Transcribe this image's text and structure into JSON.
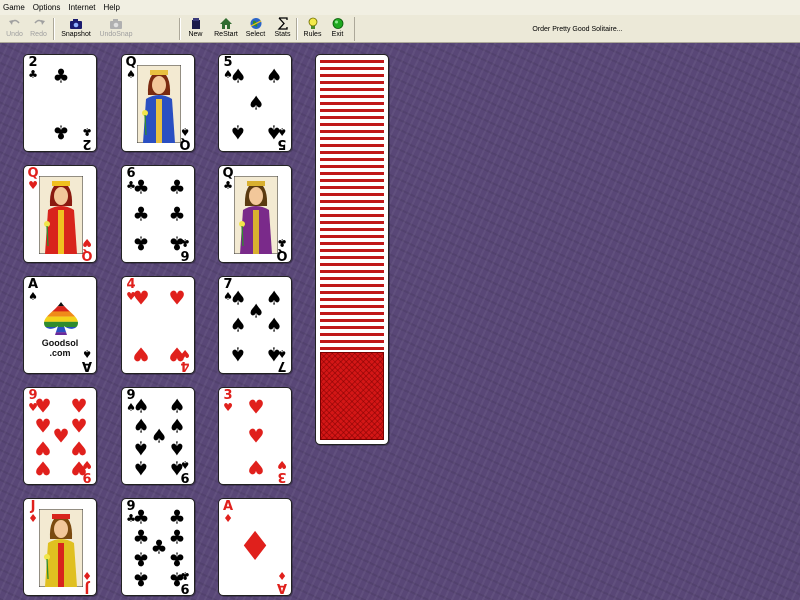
{
  "menu": [
    "Game",
    "Options",
    "Internet",
    "Help"
  ],
  "toolbar": {
    "undo": "Undo",
    "redo": "Redo",
    "snapshot": "Snapshot",
    "undosnap": "UndoSnap",
    "new": "New",
    "restart": "ReStart",
    "select": "Select",
    "stats": "Stats",
    "rules": "Rules",
    "exit": "Exit",
    "order": "Order Pretty Good Solitaire..."
  },
  "icons": {
    "undo": "undo-arrow-icon",
    "redo": "redo-arrow-icon",
    "snapshot": "camera-icon",
    "undosnap": "camera-undo-icon",
    "new": "new-deal-icon",
    "restart": "house-icon",
    "select": "globe-icon",
    "stats": "sigma-icon",
    "rules": "lightbulb-icon",
    "exit": "green-circle-icon"
  },
  "colors": {
    "table": "#594777",
    "red_suit": "#e0201c",
    "black_suit": "#000000",
    "card_back": "#d41616"
  },
  "logo": {
    "line1": "Goodsol",
    "line2": ".com"
  },
  "tableau": [
    [
      {
        "rank": "2",
        "suit": "♣",
        "color": "black"
      },
      {
        "rank": "Q",
        "suit": "♥",
        "color": "red"
      },
      {
        "rank": "A",
        "suit": "♠",
        "color": "black",
        "logo": true
      },
      {
        "rank": "9",
        "suit": "♥",
        "color": "red"
      },
      {
        "rank": "J",
        "suit": "♦",
        "color": "red"
      }
    ],
    [
      {
        "rank": "Q",
        "suit": "♠",
        "color": "black"
      },
      {
        "rank": "6",
        "suit": "♣",
        "color": "black"
      },
      {
        "rank": "4",
        "suit": "♥",
        "color": "red"
      },
      {
        "rank": "9",
        "suit": "♠",
        "color": "black"
      },
      {
        "rank": "9",
        "suit": "♣",
        "color": "black"
      }
    ],
    [
      {
        "rank": "5",
        "suit": "♠",
        "color": "black"
      },
      {
        "rank": "Q",
        "suit": "♣",
        "color": "black"
      },
      {
        "rank": "7",
        "suit": "♠",
        "color": "black"
      },
      {
        "rank": "3",
        "suit": "♥",
        "color": "red"
      },
      {
        "rank": "A",
        "suit": "♦",
        "color": "red"
      }
    ]
  ],
  "stock": {
    "card_back": "red-lattice"
  }
}
